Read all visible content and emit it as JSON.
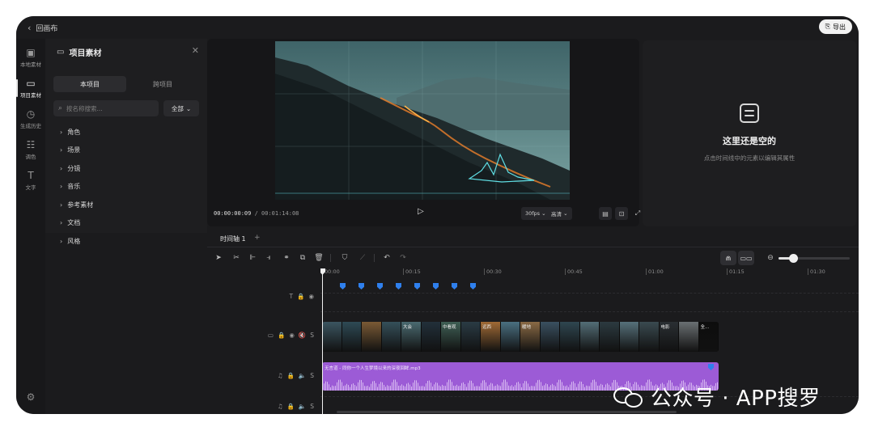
{
  "topbar": {
    "back_label": "回画布",
    "export_label": "导出"
  },
  "sidebar": {
    "items": [
      {
        "label": "本地素材",
        "icon": "image-icon"
      },
      {
        "label": "项目素材",
        "icon": "folder-icon",
        "active": true
      },
      {
        "label": "生成历史",
        "icon": "clock-icon"
      },
      {
        "label": "调色",
        "icon": "sliders-icon"
      },
      {
        "label": "文字",
        "icon": "text-icon"
      }
    ],
    "settings_icon": "gear-icon"
  },
  "assets": {
    "title": "项目素材",
    "tabs": [
      "本项目",
      "跨项目"
    ],
    "search_placeholder": "按名称搜索...",
    "filter_value": "全部",
    "tree": [
      "角色",
      "场景",
      "分镜",
      "音乐",
      "参考素材",
      "文档",
      "风格"
    ]
  },
  "preview": {
    "current_time": "00:00:00:09",
    "total_time": "00:01:14:08",
    "fps": "30fps",
    "quality": "高清"
  },
  "properties": {
    "empty_title": "这里还是空的",
    "empty_subtitle": "点击时间线中的元素以编辑其属性"
  },
  "timeline": {
    "tab_label": "时间轴 1",
    "add_label": "+",
    "ruler": [
      "00:00",
      "00:15",
      "00:30",
      "00:45",
      "01:00",
      "01:15",
      "01:30"
    ],
    "zoom_level": 0.2,
    "clip_labels": [
      "",
      "",
      "",
      "",
      "大会",
      "",
      "中看观",
      "",
      "远西",
      "",
      "暖地",
      "",
      "",
      "",
      "",
      "",
      "",
      "电影",
      "",
      "全..."
    ],
    "audio_label": "无言道 - 同你一个人生梦境以来的深夜回眸.mp3",
    "header_s": "S"
  },
  "watermark": {
    "text": "公众号 · APP搜罗"
  }
}
